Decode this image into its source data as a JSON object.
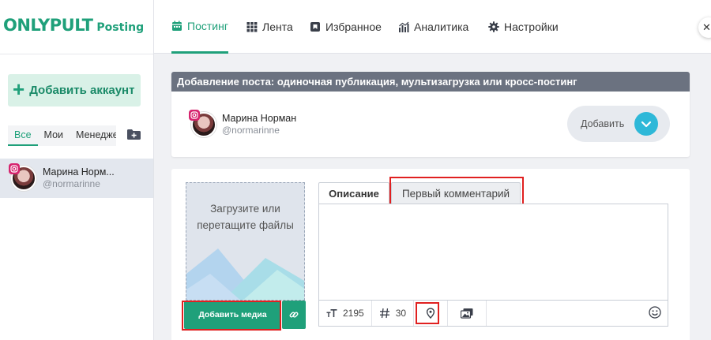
{
  "brand": {
    "name": "ONLYPULT",
    "product": "Posting"
  },
  "sidebar": {
    "add_account_label": "Добавить аккаунт",
    "filter_tabs": [
      {
        "label": "Все",
        "active": true
      },
      {
        "label": "Мои",
        "active": false
      },
      {
        "label": "Менедже",
        "active": false
      }
    ],
    "accounts": [
      {
        "name": "Марина Норм...",
        "handle": "@normarinne",
        "network_icon": "instagram-icon"
      }
    ]
  },
  "nav": {
    "items": [
      {
        "label": "Постинг",
        "icon": "calendar-icon",
        "active": true
      },
      {
        "label": "Лента",
        "icon": "grid-icon",
        "active": false
      },
      {
        "label": "Избранное",
        "icon": "bookmark-icon",
        "active": false
      },
      {
        "label": "Аналитика",
        "icon": "chart-icon",
        "active": false
      },
      {
        "label": "Настройки",
        "icon": "gear-icon",
        "active": false
      }
    ]
  },
  "post": {
    "header": "Добавление поста: одиночная публикация, мультизагрузка или кросс-постинг",
    "account": {
      "name": "Марина Норман",
      "handle": "@normarinne"
    },
    "add_label": "Добавить"
  },
  "editor": {
    "dropzone_text": "Загрузите или перетащите файлы",
    "add_media_label": "Добавить медиа",
    "tabs": [
      {
        "label": "Описание",
        "active": true
      },
      {
        "label": "Первый комментарий",
        "active": false
      }
    ],
    "text_value": "",
    "char_count": "2195",
    "hashtag_count": "30"
  },
  "colors": {
    "brand_green": "#1fa07a",
    "highlight_red": "#e02020",
    "accent_cyan": "#2eb8d8",
    "header_gray": "#6b7280"
  }
}
